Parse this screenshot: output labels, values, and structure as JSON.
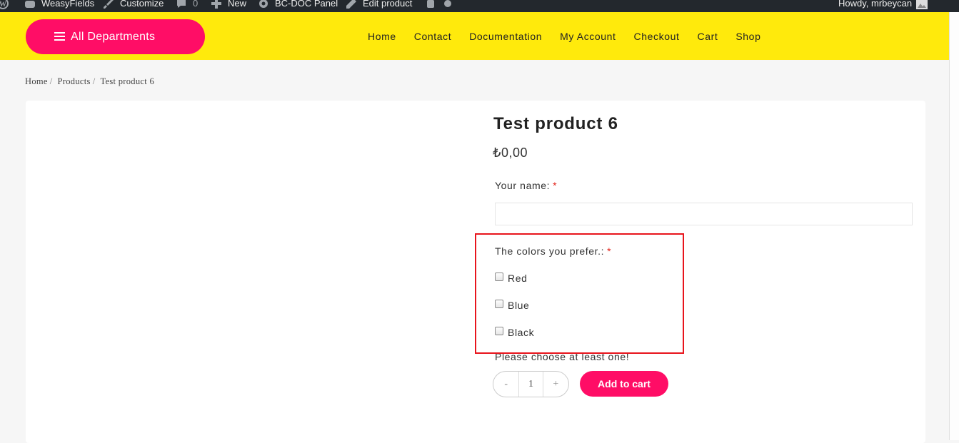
{
  "adminbar": {
    "site_name": "WeasyFields",
    "customize": "Customize",
    "comments_count": "0",
    "new_label": "New",
    "panel_label": "BC-DOC Panel",
    "edit_label": "Edit product",
    "greeting": "Howdy, mrbeycan"
  },
  "header": {
    "departments_label": "All Departments",
    "nav": [
      "Home",
      "Contact",
      "Documentation",
      "My Account",
      "Checkout",
      "Cart",
      "Shop"
    ],
    "accent_color": "#ff0d66",
    "bar_color": "#ffea0c"
  },
  "breadcrumb": {
    "items": [
      "Home",
      "Products",
      "Test product 6"
    ],
    "separator": "/"
  },
  "product": {
    "title": "Test product 6",
    "price": "₺0,00",
    "name_field": {
      "label": "Your name:",
      "required_mark": "*",
      "value": ""
    },
    "colors_field": {
      "label": "The colors you prefer.:",
      "required_mark": "*",
      "options": [
        "Red",
        "Blue",
        "Black"
      ]
    },
    "notice": "Please choose at least one!",
    "quantity": {
      "minus": "-",
      "value": "1",
      "plus": "+"
    },
    "add_to_cart": "Add to cart"
  }
}
